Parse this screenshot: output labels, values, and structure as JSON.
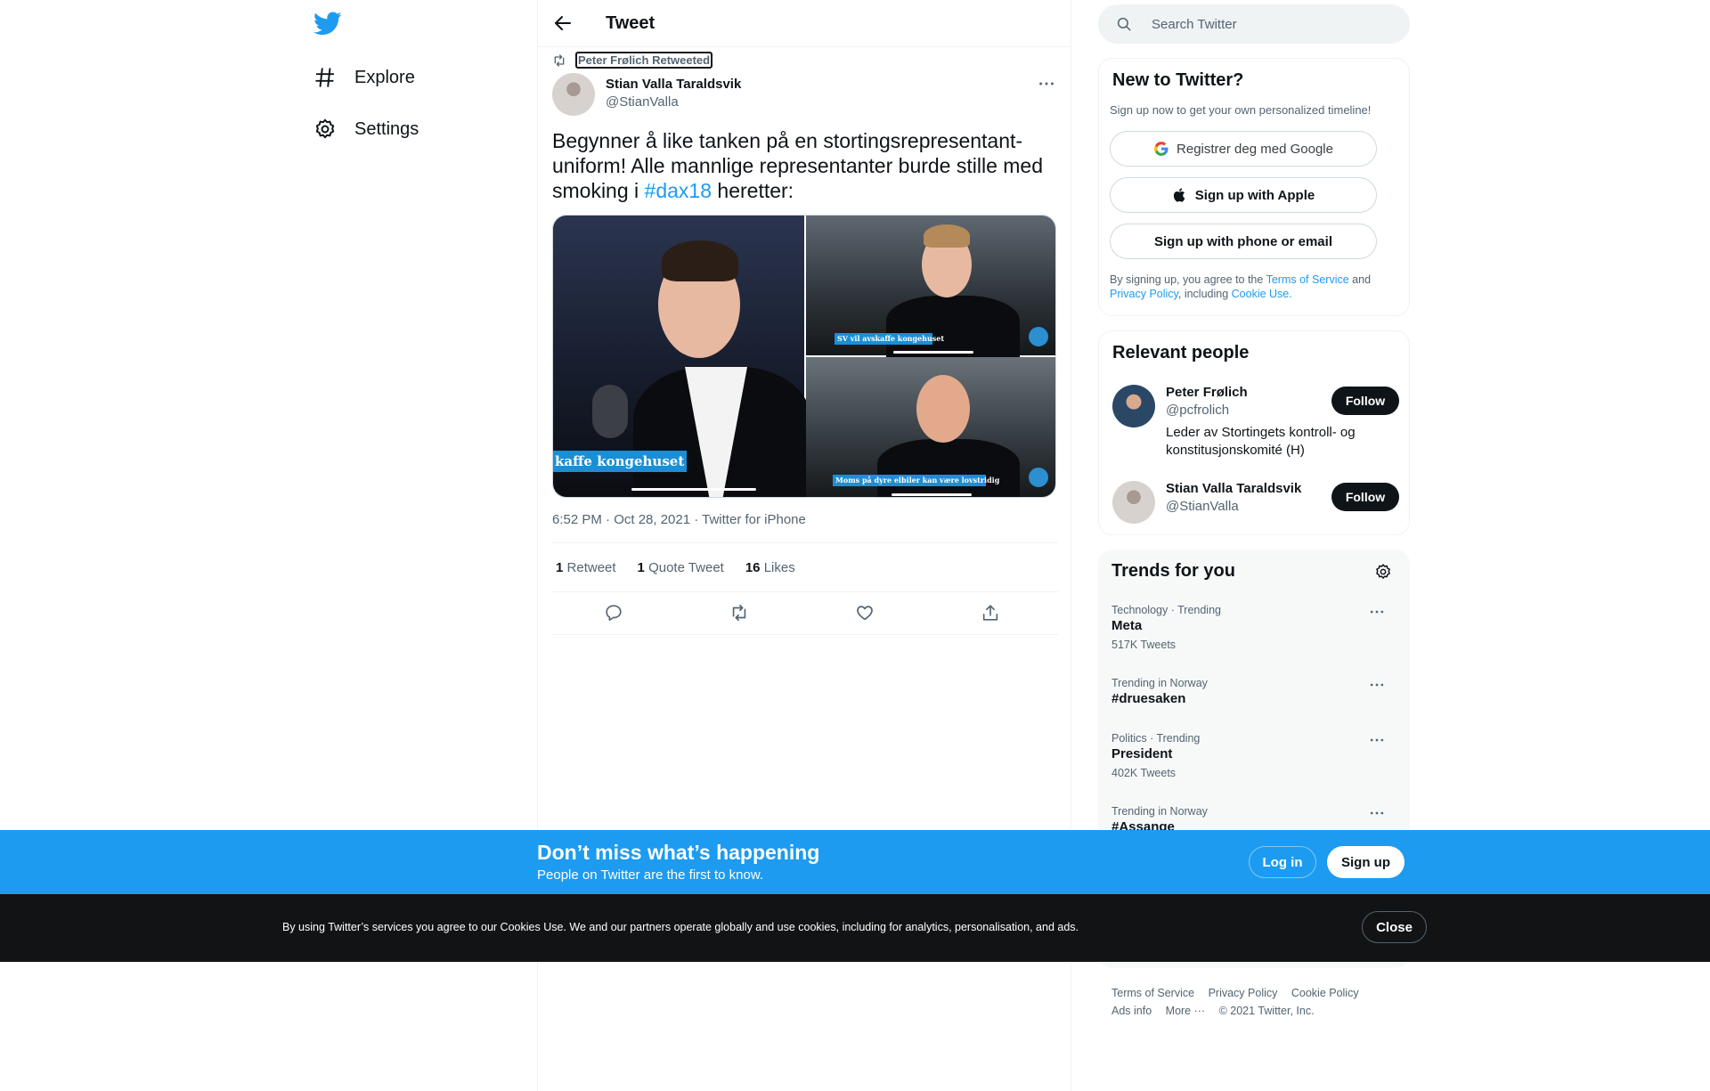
{
  "nav": {
    "explore_label": "Explore",
    "settings_label": "Settings"
  },
  "header": {
    "title": "Tweet"
  },
  "tweet": {
    "retweeted_by": "Peter Frølich Retweeted",
    "author_name": "Stian Valla Taraldsvik",
    "author_handle": "@StianValla",
    "text_before": "Begynner å like tanken på en stortingsrepresentant-uniform! Alle mannlige representanter burde stille med smoking i ",
    "hashtag": "#dax18",
    "text_after": " heretter:",
    "media": {
      "banner_1": "kaffe kongehuset",
      "banner_2": "SV vil avskaffe kongehuset",
      "banner_3": "Moms på dyre elbiler kan være lovstridig"
    },
    "meta": "6:52 PM · Oct 28, 2021 · Twitter for iPhone",
    "stats": {
      "retweets_count": "1",
      "retweets_label": "Retweet",
      "quotes_count": "1",
      "quotes_label": "Quote Tweet",
      "likes_count": "16",
      "likes_label": "Likes"
    }
  },
  "search": {
    "placeholder": "Search Twitter"
  },
  "new_to_twitter": {
    "title": "New to Twitter?",
    "subtitle": "Sign up now to get your own personalized timeline!",
    "google_label": "Registrer deg med Google",
    "apple_label": "Sign up with Apple",
    "phone_label": "Sign up with phone or email",
    "terms_prefix": "By signing up, you agree to the ",
    "terms_link": "Terms of Service",
    "terms_and": " and ",
    "privacy_link": "Privacy Policy",
    "terms_including": ", including ",
    "cookie_link": "Cookie Use."
  },
  "relevant_people": {
    "title": "Relevant people",
    "people": [
      {
        "name": "Peter Frølich",
        "handle": "@pcfrolich",
        "bio": "Leder av Stortingets kontroll- og konstitusjonskomité (H)",
        "follow_label": "Follow"
      },
      {
        "name": "Stian Valla Taraldsvik",
        "handle": "@StianValla",
        "follow_label": "Follow"
      }
    ]
  },
  "trends": {
    "title": "Trends for you",
    "items": [
      {
        "meta": "Technology · Trending",
        "name": "Meta",
        "count": "517K Tweets"
      },
      {
        "meta": "Trending in Norway",
        "name": "#druesaken"
      },
      {
        "meta": "Politics · Trending",
        "name": "President",
        "count": "402K Tweets"
      },
      {
        "meta": "Trending in Norway",
        "name": "#Assange"
      }
    ]
  },
  "footer": {
    "terms": "Terms of Service",
    "privacy": "Privacy Policy",
    "cookie": "Cookie Policy",
    "ads": "Ads info",
    "more": "More ···",
    "copyright": "© 2021 Twitter, Inc."
  },
  "signup_bar": {
    "title": "Don’t miss what’s happening",
    "subtitle": "People on Twitter are the first to know.",
    "login_label": "Log in",
    "signup_label": "Sign up"
  },
  "cookie_bar": {
    "text": "By using Twitter’s services you agree to our Cookies Use. We and our partners operate globally and use cookies, including for analytics, personalisation, and ads.",
    "close_label": "Close"
  },
  "colors": {
    "accent": "#1d9bf0",
    "text": "#0f1419",
    "secondary": "#536471",
    "cookie_bar": "#121314"
  }
}
